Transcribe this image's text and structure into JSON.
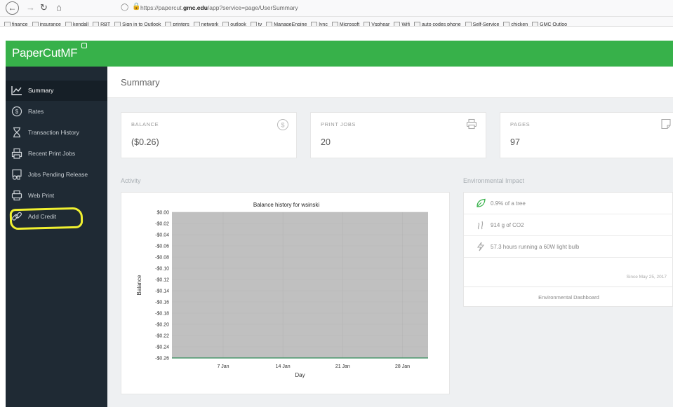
{
  "browser": {
    "url_prefix": "https://papercut.",
    "url_domain": "gmc.edu",
    "url_path": "/app?service=page/UserSummary",
    "bookmarks": [
      "finance",
      "insurance",
      "kendall",
      "RBT",
      "Sign in to Outlook",
      "printers",
      "network",
      "outlook",
      "tv",
      "ManageEngine",
      "lync",
      "Microsoft",
      "Vsphear",
      "Wifi",
      "auto codes phone",
      "Self-Service",
      "chicken",
      "GMC Outloo"
    ]
  },
  "app": {
    "logo_text": "PaperCut",
    "logo_suffix": "MF",
    "brand_color": "#37b14a"
  },
  "sidebar": {
    "items": [
      {
        "label": "Summary",
        "icon": "line-chart-icon",
        "active": true
      },
      {
        "label": "Rates",
        "icon": "dollar-circle-icon",
        "active": false
      },
      {
        "label": "Transaction History",
        "icon": "hourglass-icon",
        "active": false
      },
      {
        "label": "Recent Print Jobs",
        "icon": "print-history-icon",
        "active": false
      },
      {
        "label": "Jobs Pending Release",
        "icon": "pending-print-icon",
        "active": false
      },
      {
        "label": "Web Print",
        "icon": "web-print-icon",
        "active": false
      },
      {
        "label": "Add Credit",
        "icon": "link-icon",
        "active": false
      }
    ]
  },
  "main": {
    "page_title": "Summary",
    "cards": {
      "balance": {
        "title": "BALANCE",
        "value": "($0.26)",
        "icon": "dollar-circle-icon"
      },
      "print_jobs": {
        "title": "PRINT JOBS",
        "value": "20",
        "icon": "printer-icon"
      },
      "pages": {
        "title": "PAGES",
        "value": "97",
        "icon": "page-icon"
      }
    },
    "activity_label": "Activity",
    "environment_label": "Environmental Impact",
    "environment": {
      "rows": [
        {
          "text": "0.9% of a tree",
          "icon": "leaf-icon"
        },
        {
          "text": "914 g of CO2",
          "icon": "smoke-icon"
        },
        {
          "text": "57.3 hours running a 60W light bulb",
          "icon": "lightning-icon"
        }
      ],
      "since": "Since May 25, 2017",
      "dashboard_link": "Environmental Dashboard"
    }
  },
  "chart_data": {
    "type": "line",
    "title": "Balance history for wsinski",
    "xlabel": "Day",
    "ylabel": "Balance",
    "x_ticks": [
      "7 Jan",
      "14 Jan",
      "21 Jan",
      "28 Jan"
    ],
    "y_ticks": [
      "$0.00",
      "-$0.02",
      "-$0.04",
      "-$0.06",
      "-$0.08",
      "-$0.10",
      "-$0.12",
      "-$0.14",
      "-$0.16",
      "-$0.18",
      "-$0.20",
      "-$0.22",
      "-$0.24",
      "-$0.26"
    ],
    "ylim": [
      -0.26,
      0
    ],
    "x": [
      "1 Jan",
      "31 Jan"
    ],
    "series": [
      {
        "values": [
          -0.26,
          -0.26
        ]
      }
    ],
    "grid": true,
    "colors": {
      "plot_bg": "#c0c0c0",
      "line": "#2e8b57"
    }
  }
}
